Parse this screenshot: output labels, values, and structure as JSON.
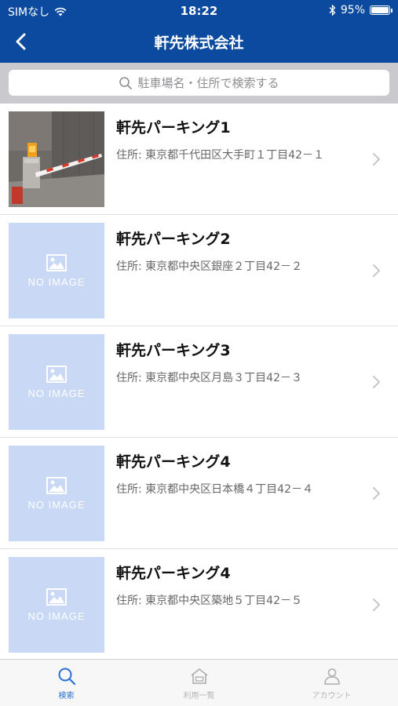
{
  "status_bar": {
    "carrier": "SIMなし",
    "time": "18:22",
    "battery": "95%",
    "battery_level": 0.95
  },
  "nav": {
    "title": "軒先株式会社",
    "back_icon": "chevron-left-icon"
  },
  "search": {
    "placeholder": "駐車場名・住所で検索する"
  },
  "list": {
    "no_image_text": "NO IMAGE",
    "items": [
      {
        "name": "軒先パーキング1",
        "address": "住所: 東京都千代田区大手町１丁目42－１",
        "has_photo": true
      },
      {
        "name": "軒先パーキング2",
        "address": "住所: 東京都中央区銀座２丁目42－２",
        "has_photo": false
      },
      {
        "name": "軒先パーキング3",
        "address": "住所: 東京都中央区月島３丁目42－３",
        "has_photo": false
      },
      {
        "name": "軒先パーキング4",
        "address": "住所: 東京都中央区日本橋４丁目42－４",
        "has_photo": false
      },
      {
        "name": "軒先パーキング4",
        "address": "住所: 東京都中央区築地５丁目42－５",
        "has_photo": false
      }
    ]
  },
  "tabs": [
    {
      "label": "検索",
      "icon": "search-icon",
      "active": true
    },
    {
      "label": "利用一覧",
      "icon": "house-icon",
      "active": false
    },
    {
      "label": "アカウント",
      "icon": "person-icon",
      "active": false
    }
  ],
  "colors": {
    "header_blue": "#0b4a9e",
    "placeholder_blue": "#c8d8f5",
    "tab_active": "#2a6fd6",
    "tab_inactive": "#b5b5b5"
  }
}
